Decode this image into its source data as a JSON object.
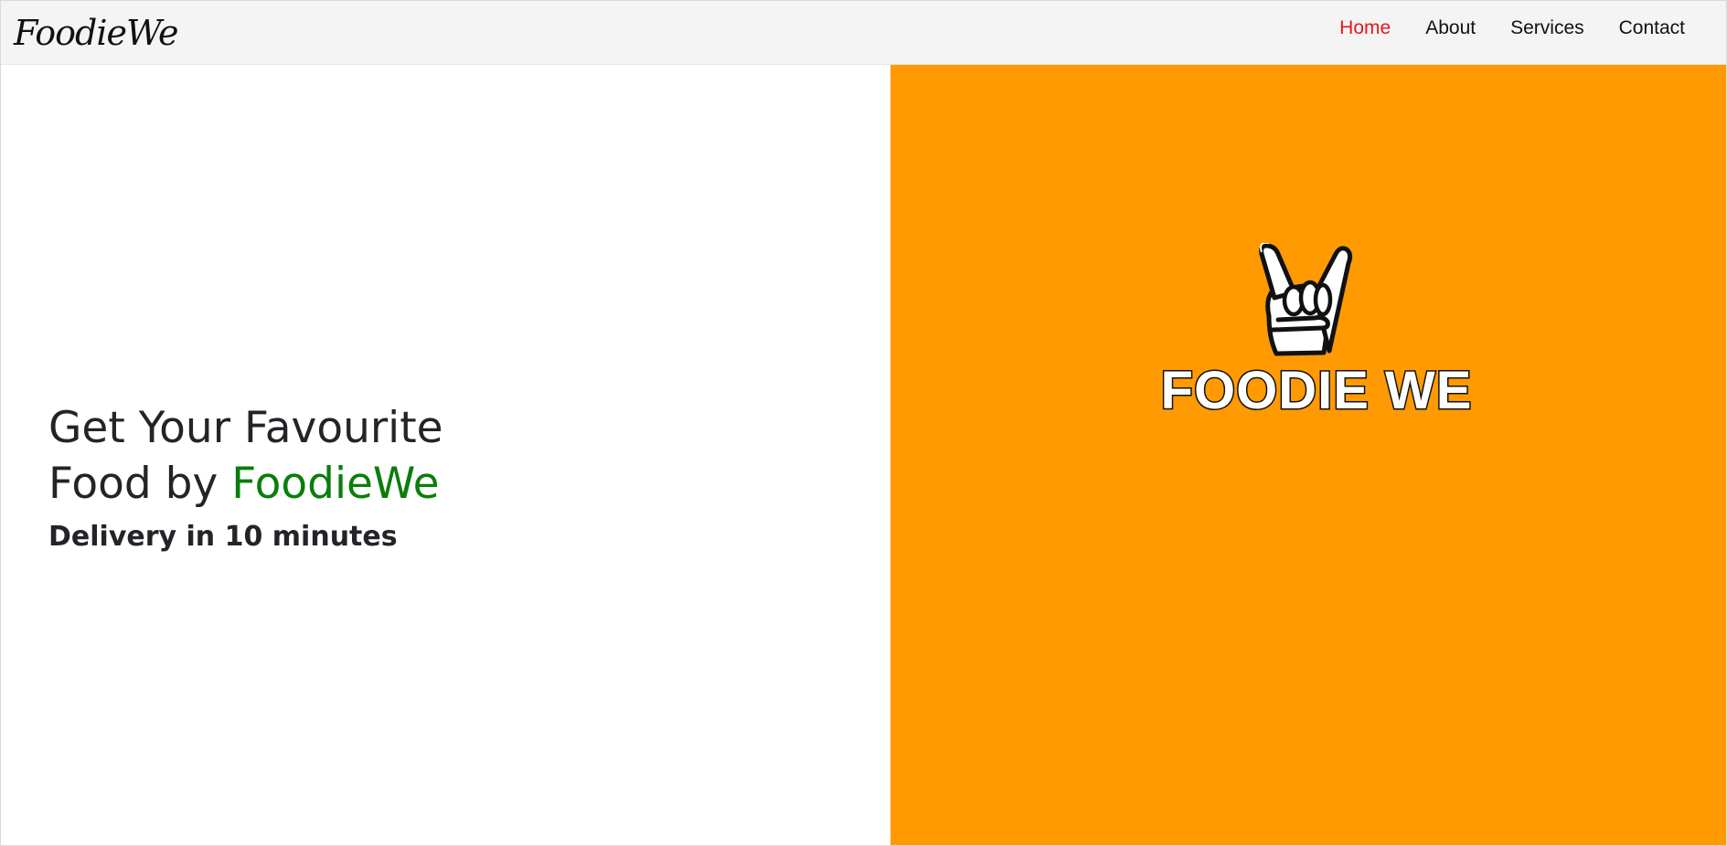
{
  "navbar": {
    "brand": "FoodieWe",
    "links": [
      {
        "label": "Home",
        "active": true
      },
      {
        "label": "About",
        "active": false
      },
      {
        "label": "Services",
        "active": false
      },
      {
        "label": "Contact",
        "active": false
      }
    ]
  },
  "hero": {
    "title_line1": "Get Your Favourite",
    "title_line2_prefix": "Food by ",
    "title_line2_accent": "FoodieWe",
    "subtitle": "Delivery in 10 minutes"
  },
  "logo": {
    "icon": "rock-hand-icon",
    "text": "FOODIE WE"
  },
  "colors": {
    "nav_background": "#f4f4f4",
    "active_link": "#e8141a",
    "accent_green": "#0a7d0a",
    "hero_orange": "#ff9a02",
    "text_dark": "#222428"
  }
}
